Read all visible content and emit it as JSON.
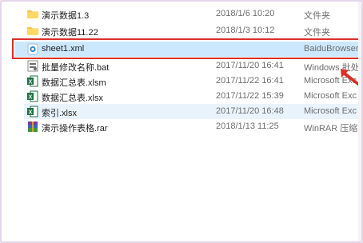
{
  "files": [
    {
      "name": "演示数据1.3",
      "date": "2018/1/6 10:20",
      "type": "文件夹",
      "icon": "folder-icon"
    },
    {
      "name": "演示数据11.22",
      "date": "2018/1/3 10:12",
      "type": "文件夹",
      "icon": "folder-icon"
    },
    {
      "name": "sheet1.xml",
      "date": "",
      "type": "BaiduBrowser",
      "icon": "browser-file-icon"
    },
    {
      "name": "批量修改名称.bat",
      "date": "2017/11/20 16:41",
      "type": "Windows 批处",
      "icon": "batch-file-icon"
    },
    {
      "name": "数据汇总表.xlsm",
      "date": "2017/11/22 16:41",
      "type": "Microsoft Exc",
      "icon": "excel-file-icon"
    },
    {
      "name": "数据汇总表.xlsx",
      "date": "2017/11/22 15:39",
      "type": "Microsoft Exc",
      "icon": "excel-file-icon"
    },
    {
      "name": "索引.xlsx",
      "date": "2017/11/20 16:48",
      "type": "Microsoft Exc",
      "icon": "excel-file-icon"
    },
    {
      "name": "演示操作表格.rar",
      "date": "2018/1/13 11:25",
      "type": "WinRAR 压缩",
      "icon": "rar-archive-icon"
    }
  ],
  "colors": {
    "highlight_border": "#d9302a",
    "hover_row": "#e9f3fc",
    "selected_row": "#cce8ff",
    "arrow": "#d9302a"
  }
}
